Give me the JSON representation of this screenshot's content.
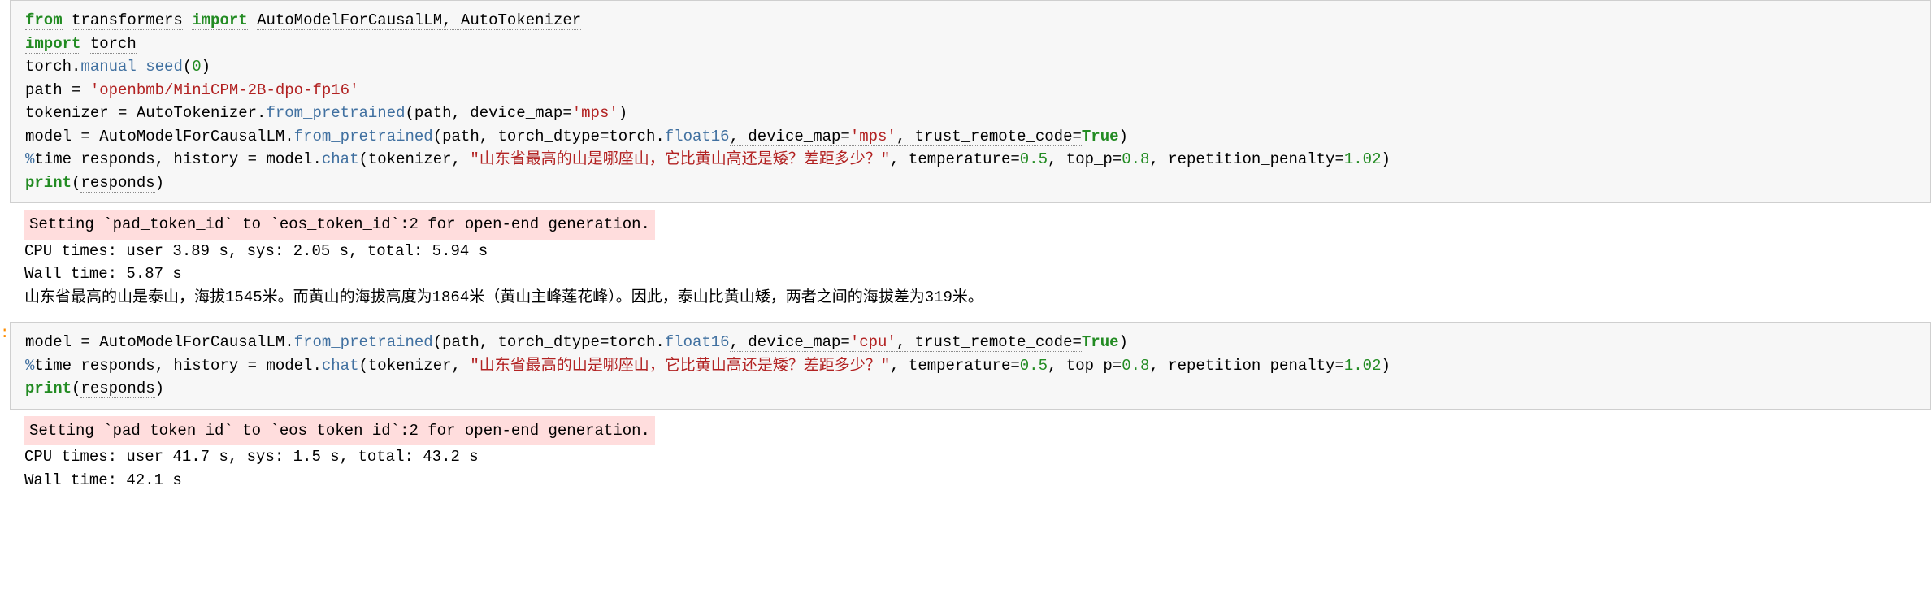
{
  "cell1": {
    "line1": {
      "from": "from",
      "transformers": "transformers",
      "import": "import",
      "items": "AutoModelForCausalLM, AutoTokenizer"
    },
    "line2": {
      "import": "import",
      "torch": "torch"
    },
    "line3": {
      "torch": "torch",
      "dot": ".",
      "manual_seed": "manual_seed",
      "open": "(",
      "val": "0",
      "close": ")"
    },
    "line4": {
      "path": "path = ",
      "str": "'openbmb/MiniCPM-2B-dpo-fp16'"
    },
    "line5": {
      "tokenizer": "tokenizer = AutoTokenizer",
      "dot": ".",
      "from_pretrained": "from_pretrained",
      "open": "(",
      "path": "path, device_map=",
      "mps": "'mps'",
      "close": ")"
    },
    "line6": {
      "model": "model = AutoModelForCausalLM",
      "dot": ".",
      "from_pretrained": "from_pretrained",
      "open": "(",
      "path": "path, torch_dtype=torch",
      "dot2": ".",
      "float16": "float16",
      "devmap": ", device_map=",
      "mps": "'mps'",
      "trust": ", trust_remote_code=",
      "true": "True",
      "close": ")"
    },
    "line7": {
      "magic": "%",
      "time": "time responds, history = model",
      "dot": ".",
      "chat": "chat",
      "open": "(",
      "tok": "tokenizer, ",
      "str": "\"山东省最高的山是哪座山，它比黄山高还是矮？差距多少？\"",
      "temp": ", temperature=",
      "tempval": "0.5",
      "topp": ", top_p=",
      "toppval": "0.8",
      "rep": ", repetition_penalty=",
      "repval": "1.02",
      "close": ")"
    },
    "line8": {
      "print": "print",
      "open": "(",
      "responds": "responds",
      "close": ")"
    }
  },
  "output1": {
    "stderr": "Setting `pad_token_id` to `eos_token_id`:2 for open-end generation.",
    "cpu": "CPU times: user 3.89 s, sys: 2.05 s, total: 5.94 s",
    "wall": "Wall time: 5.87 s",
    "text": "山东省最高的山是泰山，海拔1545米。而黄山的海拔高度为1864米（黄山主峰莲花峰）。因此，泰山比黄山矮，两者之间的海拔差为319米。"
  },
  "cell2": {
    "line1": {
      "model": "model = AutoModelForCausalLM",
      "dot": ".",
      "from_pretrained": "from_pretrained",
      "open": "(",
      "path": "path, torch_dtype=torch",
      "dot2": ".",
      "float16": "float16",
      "devmap": ", device_map=",
      "cpu": "'cpu'",
      "trust": ", trust_remote_code=",
      "true": "True",
      "close": ")"
    },
    "line2": {
      "magic": "%",
      "time": "time responds, history = model",
      "dot": ".",
      "chat": "chat",
      "open": "(",
      "tok": "tokenizer, ",
      "str": "\"山东省最高的山是哪座山，它比黄山高还是矮？差距多少？\"",
      "temp": ", temperature=",
      "tempval": "0.5",
      "topp": ", top_p=",
      "toppval": "0.8",
      "rep": ", repetition_penalty=",
      "repval": "1.02",
      "close": ")"
    },
    "line3": {
      "print": "print",
      "open": "(",
      "responds": "responds",
      "close": ")"
    }
  },
  "output2": {
    "stderr": "Setting `pad_token_id` to `eos_token_id`:2 for open-end generation.",
    "cpu": "CPU times: user 41.7 s, sys: 1.5 s, total: 43.2 s",
    "wall": "Wall time: 42.1 s"
  },
  "prompt": ":"
}
